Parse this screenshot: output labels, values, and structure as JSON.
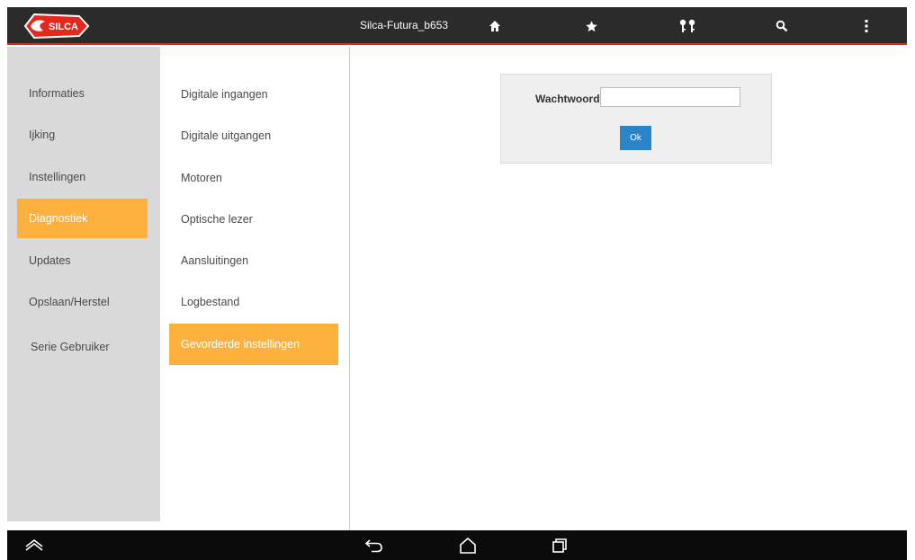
{
  "app": {
    "title": "Silca-Futura_b653",
    "logo_text": "SILCA",
    "brand_color": "#e4281e",
    "accent_color": "#fdb13c",
    "button_color": "#2a85c8"
  },
  "topbar": {
    "icons": [
      "home-icon",
      "star-icon",
      "keys-icon",
      "search-icon",
      "overflow-menu-icon"
    ]
  },
  "sidebar": {
    "items": [
      {
        "label": "Informaties",
        "active": false
      },
      {
        "label": "Ijking",
        "active": false
      },
      {
        "label": "Instellingen",
        "active": false
      },
      {
        "label": "Diagnostiek",
        "active": true
      },
      {
        "label": "Updates",
        "active": false
      },
      {
        "label": "Opslaan/Herstel",
        "active": false
      },
      {
        "label": "Serie Gebruiker",
        "active": false
      }
    ]
  },
  "submenu": {
    "items": [
      {
        "label": "Digitale ingangen",
        "active": false
      },
      {
        "label": "Digitale uitgangen",
        "active": false
      },
      {
        "label": "Motoren",
        "active": false
      },
      {
        "label": "Optische lezer",
        "active": false
      },
      {
        "label": "Aansluitingen",
        "active": false
      },
      {
        "label": "Logbestand",
        "active": false
      },
      {
        "label": "Gevorderde instellingen",
        "active": true
      }
    ]
  },
  "password_panel": {
    "label": "Wachtwoord",
    "value": "",
    "ok_label": "Ok"
  },
  "navbar": {
    "icons": [
      "hide-keyboard-icon",
      "back-icon",
      "android-home-icon",
      "recent-apps-icon"
    ]
  }
}
